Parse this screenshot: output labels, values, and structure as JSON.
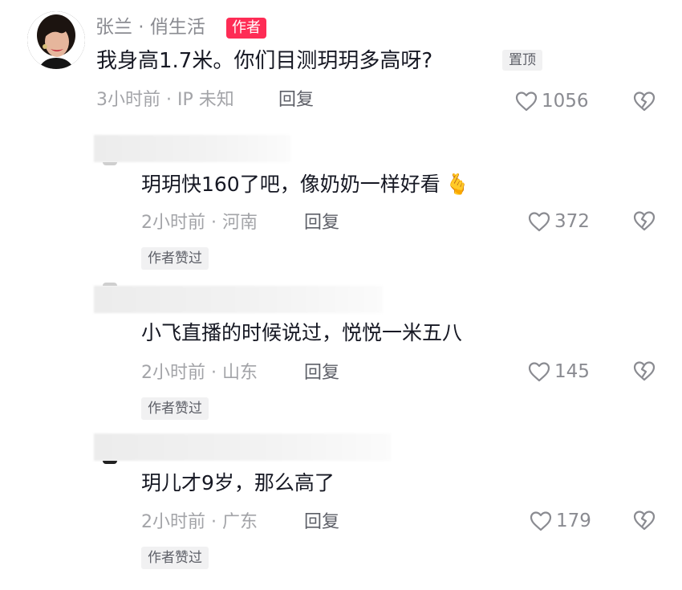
{
  "top_comment": {
    "author": "张兰 · 俏生活",
    "author_badge": "作者",
    "text": "我身高1.7米。你们目测玥玥多高呀?",
    "pinned_label": "置顶",
    "meta": "3小时前 · IP 未知",
    "reply_label": "回复",
    "likes": "1056"
  },
  "replies": [
    {
      "text": "玥玥快160了吧，像奶奶一样好看",
      "emoji": "🫰",
      "meta": "2小时前 · 河南",
      "reply_label": "回复",
      "likes": "372",
      "author_liked": "作者赞过"
    },
    {
      "text": "小飞直播的时候说过，悦悦一米五八",
      "meta": "2小时前 · 山东",
      "reply_label": "回复",
      "likes": "145",
      "author_liked": "作者赞过"
    },
    {
      "text": "玥儿才9岁，那么高了",
      "meta": "2小时前 · 广东",
      "reply_label": "回复",
      "likes": "179",
      "author_liked": "作者赞过"
    }
  ],
  "colors": {
    "badge": "#fe2c55",
    "secondary_text": "#8a8b91",
    "tag_bg": "#f1f1f2"
  },
  "icons": {
    "like": "heart-outline-icon",
    "dislike": "broken-heart-icon"
  }
}
